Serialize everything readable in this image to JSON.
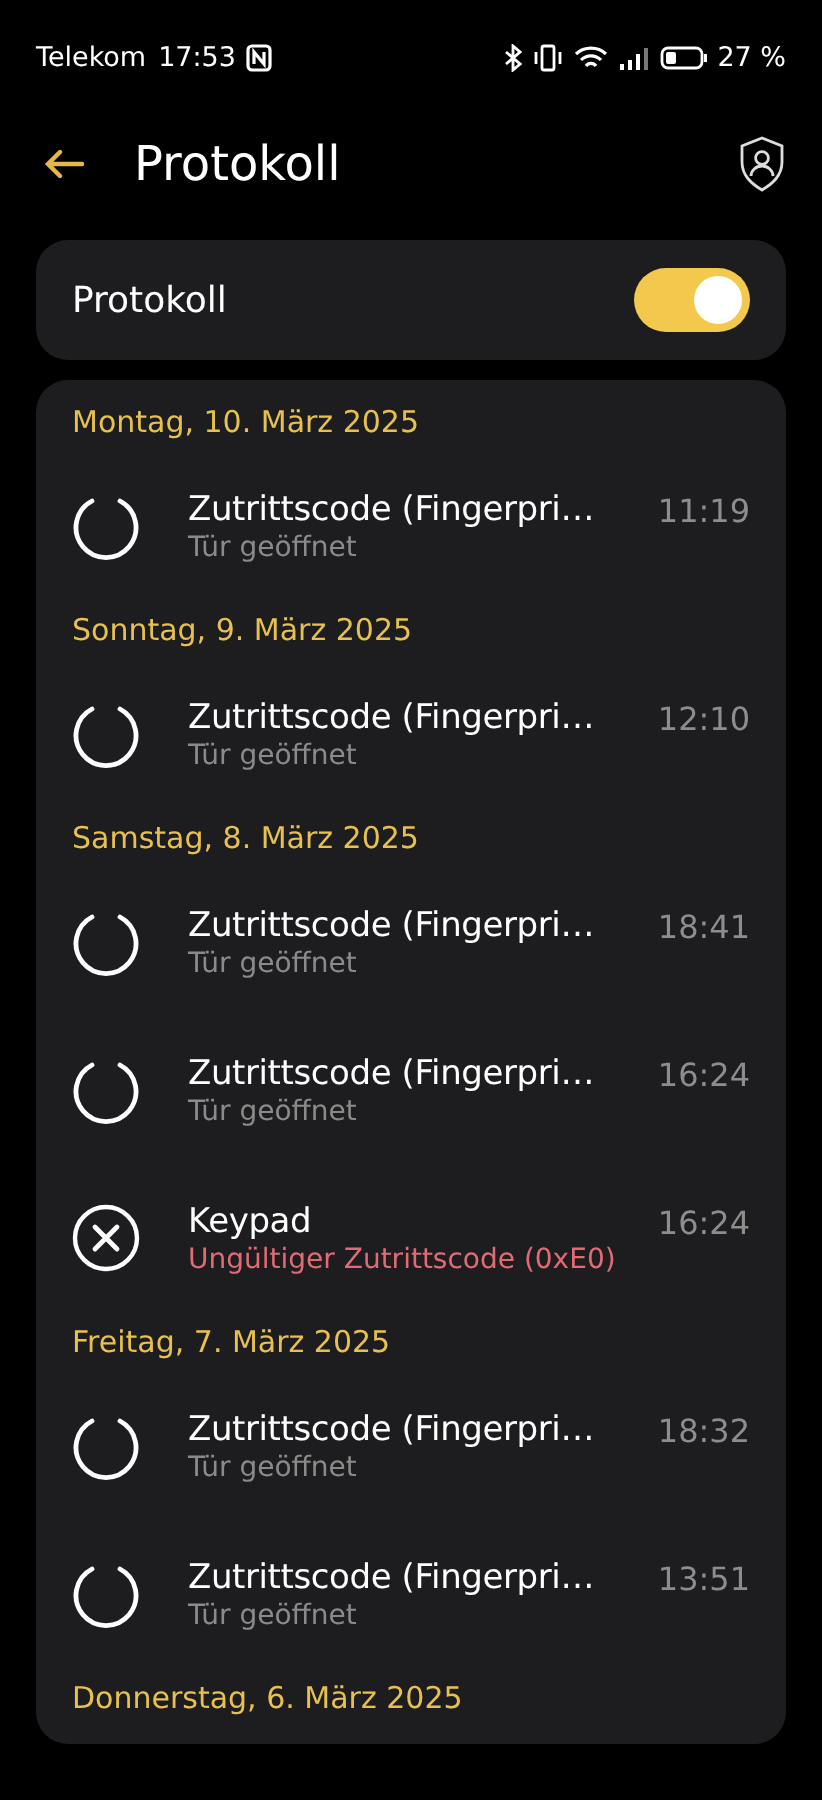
{
  "status_bar": {
    "carrier": "Telekom",
    "time": "17:53",
    "battery": "27 %"
  },
  "header": {
    "title": "Protokoll"
  },
  "toggle_card": {
    "label": "Protokoll",
    "on": true
  },
  "log": [
    {
      "date": "Montag, 10. März 2025",
      "entries": [
        {
          "kind": "opened",
          "title": "Zutrittscode (Fingerpri…",
          "subtitle": "Tür geöffnet",
          "time": "11:19"
        }
      ]
    },
    {
      "date": "Sonntag, 9. März 2025",
      "entries": [
        {
          "kind": "opened",
          "title": "Zutrittscode (Fingerpri…",
          "subtitle": "Tür geöffnet",
          "time": "12:10"
        }
      ]
    },
    {
      "date": "Samstag, 8. März 2025",
      "entries": [
        {
          "kind": "opened",
          "title": "Zutrittscode (Fingerpri…",
          "subtitle": "Tür geöffnet",
          "time": "18:41"
        },
        {
          "kind": "opened",
          "title": "Zutrittscode (Fingerpri…",
          "subtitle": "Tür geöffnet",
          "time": "16:24"
        },
        {
          "kind": "error",
          "title": "Keypad",
          "subtitle": "Ungültiger Zutrittscode (0xE0)",
          "time": "16:24"
        }
      ]
    },
    {
      "date": "Freitag, 7. März 2025",
      "entries": [
        {
          "kind": "opened",
          "title": "Zutrittscode (Fingerpri…",
          "subtitle": "Tür geöffnet",
          "time": "18:32"
        },
        {
          "kind": "opened",
          "title": "Zutrittscode (Fingerpri…",
          "subtitle": "Tür geöffnet",
          "time": "13:51"
        }
      ]
    },
    {
      "date": "Donnerstag, 6. März 2025"
    }
  ]
}
